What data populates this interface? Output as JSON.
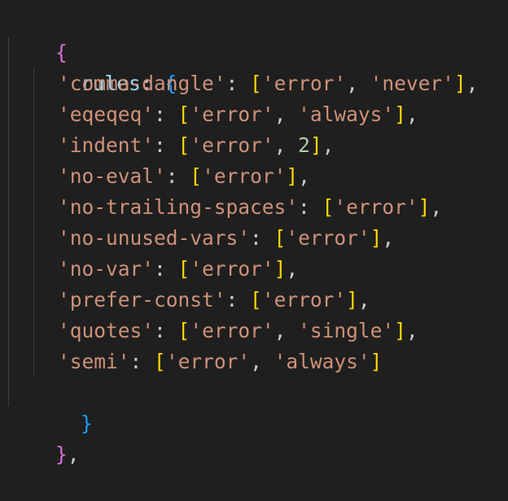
{
  "code": {
    "open_brace": "{",
    "rules_key": "rules",
    "colon": ":",
    "rules_open": "{",
    "rules_close": "}",
    "close_brace": "}",
    "trailing_comma": ",",
    "rules": [
      {
        "key": "'comma-dangle'",
        "values": [
          "'error'",
          "'never'"
        ]
      },
      {
        "key": "'eqeqeq'",
        "values": [
          "'error'",
          "'always'"
        ]
      },
      {
        "key": "'indent'",
        "values": [
          "'error'",
          "2"
        ]
      },
      {
        "key": "'no-eval'",
        "values": [
          "'error'"
        ]
      },
      {
        "key": "'no-trailing-spaces'",
        "values": [
          "'error'"
        ]
      },
      {
        "key": "'no-unused-vars'",
        "values": [
          "'error'"
        ]
      },
      {
        "key": "'no-var'",
        "values": [
          "'error'"
        ]
      },
      {
        "key": "'prefer-const'",
        "values": [
          "'error'"
        ]
      },
      {
        "key": "'quotes'",
        "values": [
          "'error'",
          "'single'"
        ]
      },
      {
        "key": "'semi'",
        "values": [
          "'error'",
          "'always'"
        ]
      }
    ]
  },
  "colors": {
    "background": "#1f1f1f",
    "bracket_level_1": "#da70d6",
    "bracket_level_2": "#179fff",
    "bracket_level_3": "#ffd700",
    "property_key": "#9cdcfe",
    "string": "#ce9178",
    "number": "#b5cea8",
    "indent_guide": "#404040"
  }
}
